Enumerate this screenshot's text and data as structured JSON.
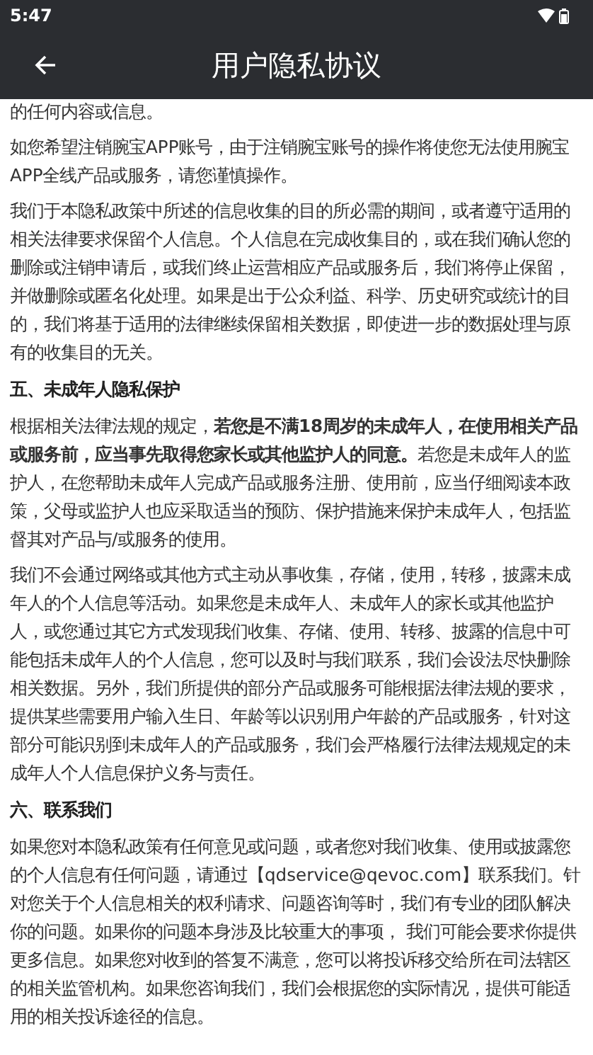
{
  "status_bar": {
    "time": "5:47"
  },
  "header": {
    "title": "用户隐私协议"
  },
  "blocks": [
    {
      "kind": "paragraph",
      "text": "的任何内容或信息。"
    },
    {
      "kind": "paragraph",
      "text": "如您希望注销腕宝APP账号，由于注销腕宝账号的操作将使您无法使用腕宝APP全线产品或服务，请您谨慎操作。"
    },
    {
      "kind": "paragraph",
      "text": "我们于本隐私政策中所述的信息收集的目的所必需的期间，或者遵守适用的相关法律要求保留个人信息。个人信息在完成收集目的，或在我们确认您的删除或注销申请后，或我们终止运营相应产品或服务后，我们将停止保留，并做删除或匿名化处理。如果是出于公众利益、科学、历史研究或统计的目的，我们将基于适用的法律继续保留相关数据，即使进一步的数据处理与原有的收集目的无关。"
    },
    {
      "kind": "heading",
      "text": "五、未成年人隐私保护"
    },
    {
      "kind": "paragraph",
      "text": "根据相关法律法规的规定，**若您是不满18周岁的未成年人，在使用相关产品或服务前，应当事先取得您家长或其他监护人的同意。**若您是未成年人的监护人，在您帮助未成年人完成产品或服务注册、使用前，应当仔细阅读本政策，父母或监护人也应采取适当的预防、保护措施来保护未成年人，包括监督其对产品与/或服务的使用。"
    },
    {
      "kind": "paragraph",
      "text": "我们不会通过网络或其他方式主动从事收集，存储，使用，转移，披露未成年人的个人信息等活动。如果您是未成年人、未成年人的家长或其他监护人，或您通过其它方式发现我们收集、存储、使用、转移、披露的信息中可能包括未成年人的个人信息，您可以及时与我们联系，我们会设法尽快删除相关数据。另外，我们所提供的部分产品或服务可能根据法律法规的要求，提供某些需要用户输入生日、年龄等以识别用户年龄的产品或服务，针对这部分可能识别到未成年人的产品或服务，我们会严格履行法律法规规定的未成年人个人信息保护义务与责任。"
    },
    {
      "kind": "heading",
      "text": "六、联系我们"
    },
    {
      "kind": "paragraph",
      "text": "如果您对本隐私政策有任何意见或问题，或者您对我们收集、使用或披露您的个人信息有任何问题，请通过【qdservice@qevoc.com】联系我们。针对您关于个人信息相关的权利请求、问题咨询等时，我们有专业的团队解决你的问题。如果你的问题本身涉及比较重大的事项， 我们可能会要求你提供更多信息。如果您对收到的答复不满意，您可以将投诉移交给所在司法辖区的相关监管机构。如果您咨询我们，我们会根据您的实际情况，提供可能适用的相关投诉途径的信息。"
    }
  ]
}
